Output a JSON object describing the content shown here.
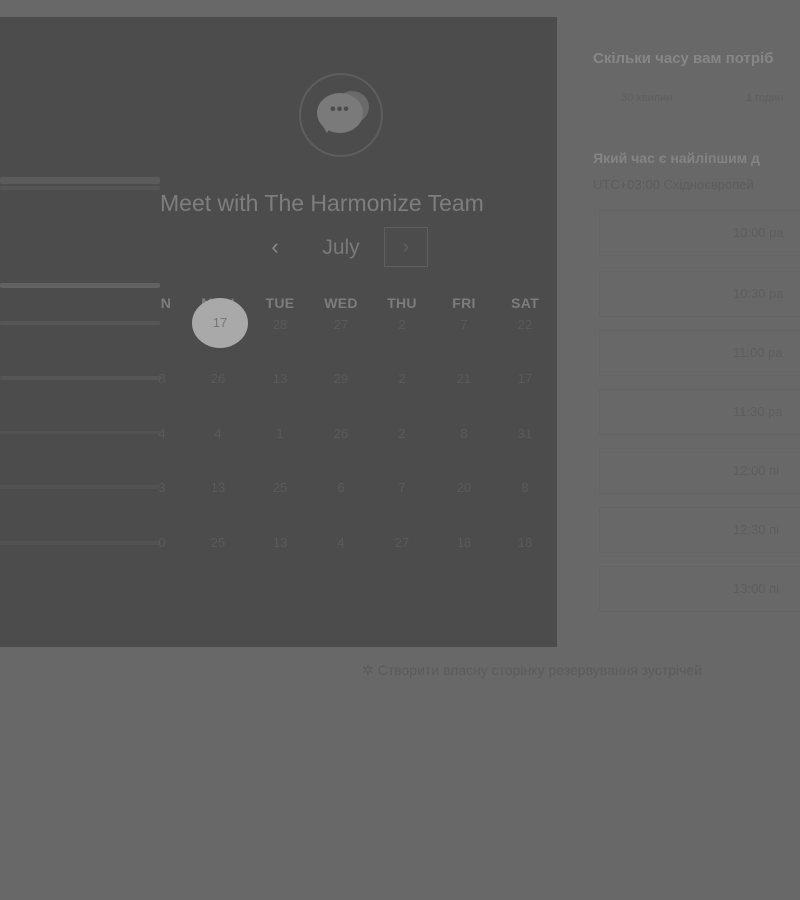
{
  "header": {
    "title": "Meet with The Harmonize Team",
    "logo_icon": "chat-bubble-icon",
    "logo_glyph": "•••"
  },
  "calendar": {
    "month": "July",
    "prev_glyph": "‹",
    "next_glyph": "›",
    "weekdays": [
      "N",
      "MON",
      "TUE",
      "WED",
      "THU",
      "FRI",
      "SAT"
    ],
    "selected_day": "17",
    "rows": [
      [
        "",
        "17",
        "28",
        "27",
        "2",
        "7",
        "22"
      ],
      [
        "8",
        "26",
        "13",
        "29",
        "2",
        "21",
        "17"
      ],
      [
        "4",
        "4",
        "1",
        "26",
        "2",
        "8",
        "31"
      ],
      [
        "3",
        "13",
        "25",
        "6",
        "7",
        "20",
        "8"
      ],
      [
        "0",
        "25",
        "13",
        "4",
        "27",
        "18",
        "18"
      ]
    ]
  },
  "scheduler": {
    "duration_question": "Скільки часу вам потріб",
    "durations": [
      "30 хвилин",
      "1 годин"
    ],
    "time_question": "Який час є найліпшим д",
    "timezone": "UTC+03:00 Східноєвропей",
    "slots": [
      "10:00 ра",
      "10:30 ра",
      "11:00 ра",
      "11:30 ра",
      "12:00 пі",
      "12:30 пі",
      "13:00 пі"
    ]
  },
  "footer": {
    "text": "Створити власну сторінку резервування зустрічей",
    "icon": "sparkle-icon",
    "icon_glyph": "✲"
  },
  "colors": {
    "page_background": "#686868",
    "card_background": "#4c4c4c",
    "selected_day": "#a9a9a9"
  }
}
